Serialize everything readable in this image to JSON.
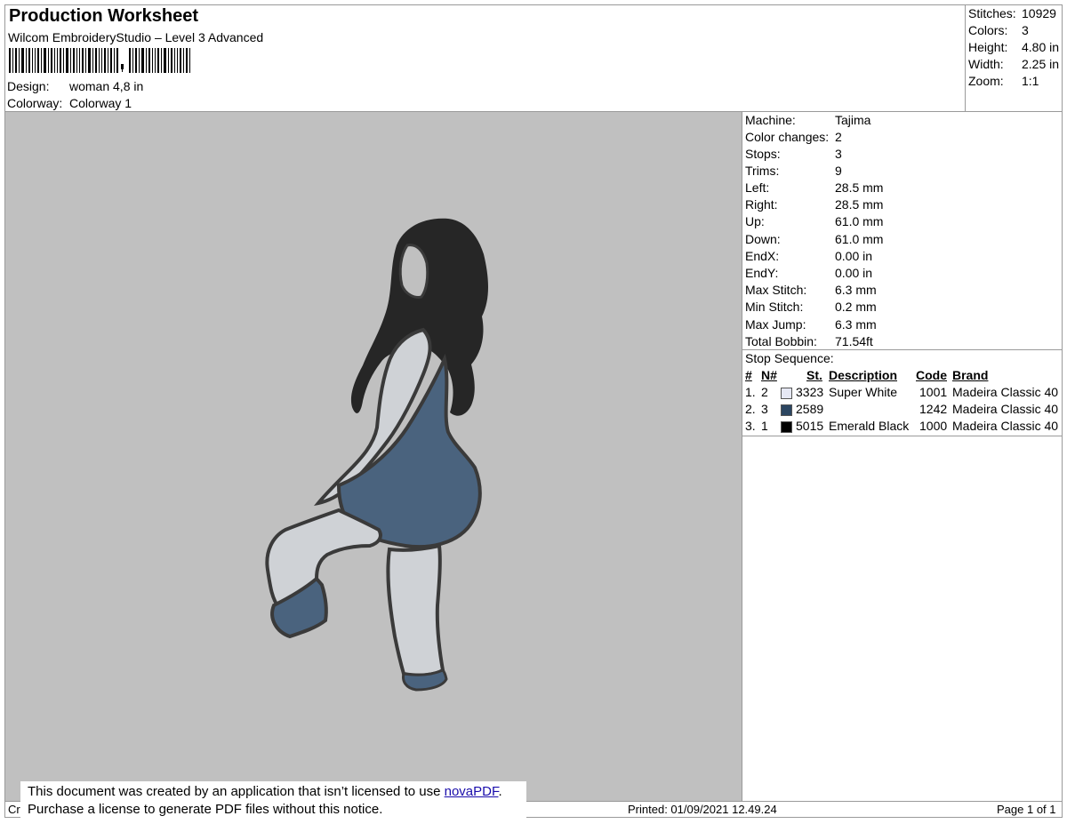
{
  "header": {
    "title": "Production Worksheet",
    "software": "Wilcom EmbroideryStudio – Level 3 Advanced",
    "design_label": "Design:",
    "design_value": "woman 4,8 in",
    "colorway_label": "Colorway:",
    "colorway_value": "Colorway 1"
  },
  "summary": [
    {
      "label": "Stitches:",
      "value": "10929"
    },
    {
      "label": "Colors:",
      "value": "3"
    },
    {
      "label": "Height:",
      "value": "4.80 in"
    },
    {
      "label": "Width:",
      "value": "2.25 in"
    },
    {
      "label": "Zoom:",
      "value": "1:1"
    }
  ],
  "machine_info": [
    {
      "label": "Machine:",
      "value": "Tajima"
    },
    {
      "label": "Color changes:",
      "value": "2"
    },
    {
      "label": "Stops:",
      "value": "3"
    },
    {
      "label": "Trims:",
      "value": "9"
    },
    {
      "label": "Left:",
      "value": "28.5 mm"
    },
    {
      "label": "Right:",
      "value": "28.5 mm"
    },
    {
      "label": "Up:",
      "value": "61.0 mm"
    },
    {
      "label": "Down:",
      "value": "61.0 mm"
    },
    {
      "label": "EndX:",
      "value": "0.00 in"
    },
    {
      "label": "EndY:",
      "value": "0.00 in"
    },
    {
      "label": "Max Stitch:",
      "value": "6.3 mm"
    },
    {
      "label": "Min Stitch:",
      "value": "0.2 mm"
    },
    {
      "label": "Max Jump:",
      "value": "6.3 mm"
    },
    {
      "label": "Total Bobbin:",
      "value": "71.54ft"
    }
  ],
  "stop_sequence": {
    "title": "Stop Sequence:",
    "headers": {
      "num": "#",
      "n": "N#",
      "st": "St.",
      "description": "Description",
      "code": "Code",
      "brand": "Brand"
    },
    "rows": [
      {
        "num": "1.",
        "n": "2",
        "color": "#e6e8f4",
        "st": "3323",
        "description": "Super White",
        "code": "1001",
        "brand": "Madeira Classic 40"
      },
      {
        "num": "2.",
        "n": "3",
        "color": "#2c4661",
        "st": "2589",
        "description": "",
        "code": "1242",
        "brand": "Madeira Classic 40"
      },
      {
        "num": "3.",
        "n": "1",
        "color": "#000000",
        "st": "5015",
        "description": "Emerald Black",
        "code": "1000",
        "brand": "Madeira Classic 40"
      }
    ]
  },
  "footer": {
    "left_fragment": "Cr",
    "printed": "Printed: 01/09/2021 12.49.24",
    "page": "Page 1 of 1"
  },
  "notice": {
    "line1_prefix": "This document was created by an application that isn’t licensed to use ",
    "link": "novaPDF",
    "line1_suffix": ".",
    "line2": "Purchase a license to generate PDF files without this notice."
  },
  "colors": {
    "canvas": "#c0c0c0",
    "outline": "#3a3a3a",
    "hair": "#262626",
    "fabric": "#4a637e",
    "skin": "#cfd2d6"
  }
}
